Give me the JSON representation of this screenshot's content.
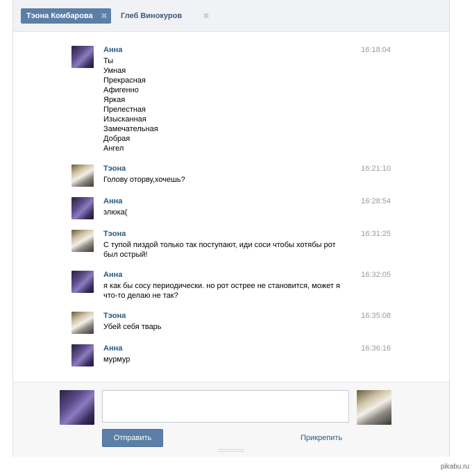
{
  "tabs": [
    {
      "label": "Тэона Комбарова",
      "active": true
    },
    {
      "label": "Глеб Винокуров",
      "active": false
    }
  ],
  "messages": [
    {
      "author": "Анна",
      "time": "16:18:04",
      "lines": [
        "Ты",
        "Умная",
        "Прекрасная",
        "Афигенно",
        "Яркая",
        "Прелестная",
        "Изысканная",
        "Замечательная",
        "Добрая",
        "Ангел"
      ]
    },
    {
      "author": "Тэона",
      "time": "16:21:10",
      "lines": [
        "Голову оторву,хочешь?"
      ]
    },
    {
      "author": "Анна",
      "time": "16:28:54",
      "lines": [
        "злюка("
      ]
    },
    {
      "author": "Тэона",
      "time": "16:31:25",
      "lines": [
        "С тупой пиздой только так поступают, иди соси чтобы хотябы рот",
        "был острый!"
      ]
    },
    {
      "author": "Анна",
      "time": "16:32:05",
      "lines": [
        "я как бы сосу периодически. но рот острее не становится, может я",
        "что-то делаю не так?"
      ]
    },
    {
      "author": "Тэона",
      "time": "16:35:08",
      "lines": [
        "Убей себя тварь"
      ]
    },
    {
      "author": "Анна",
      "time": "16:36:16",
      "lines": [
        "мурмур"
      ]
    }
  ],
  "composer": {
    "input_value": "",
    "send_label": "Отправить",
    "attach_label": "Прикрепить"
  },
  "watermark": "pikabu.ru",
  "colors": {
    "accent": "#5b7fa6",
    "name_link": "#2b587a"
  }
}
